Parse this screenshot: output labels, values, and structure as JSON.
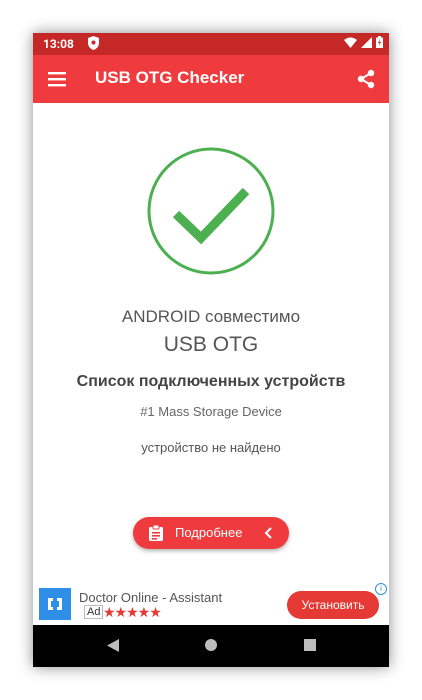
{
  "status_bar": {
    "time": "13:08"
  },
  "app_bar": {
    "title": "USB OTG Checker"
  },
  "result": {
    "compatible_line1": "ANDROID совместимо",
    "compatible_line2": "USB OTG"
  },
  "devices": {
    "title": "Список подключенных устройств",
    "items": [
      "#1 Mass Storage Device"
    ],
    "status": "устройство не найдено"
  },
  "details_button": {
    "label": "Подробнее"
  },
  "ad": {
    "name": "Doctor Online -  Assistant",
    "badge": "Ad",
    "rating_stars": "★★★★★",
    "install_label": "Установить",
    "info_glyph": "i"
  },
  "colors": {
    "app_bar": "#ef3b3d",
    "status_bar": "#c62828",
    "check": "#4caf50",
    "ad_logo": "#2f8ee5"
  }
}
